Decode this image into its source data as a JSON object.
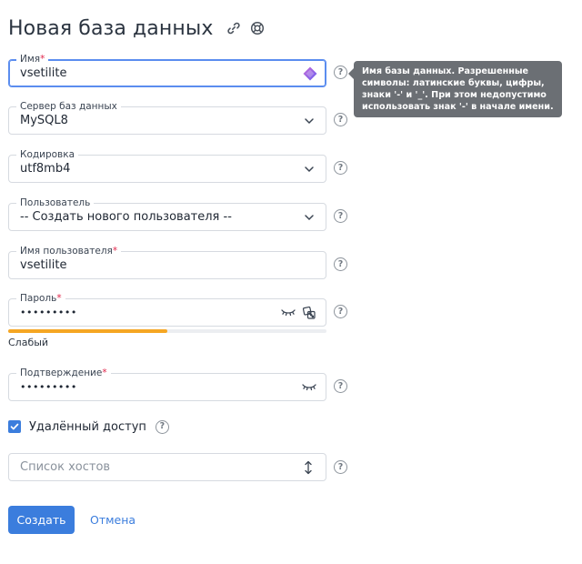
{
  "page": {
    "title": "Новая база данных"
  },
  "tooltip": {
    "text": "Имя базы данных. Разрешенные символы: латинские буквы, цифры, знаки '-' и '_'. При этом недопустимо использовать знак '-' в начале имени."
  },
  "fields": {
    "name": {
      "label": "Имя",
      "value": "vsetilite"
    },
    "server": {
      "label": "Сервер баз данных",
      "value": "MySQL8"
    },
    "encoding": {
      "label": "Кодировка",
      "value": "utf8mb4"
    },
    "user": {
      "label": "Пользователь",
      "value": "-- Создать нового пользователя --"
    },
    "username": {
      "label": "Имя пользователя",
      "value": "vsetilite"
    },
    "password": {
      "label": "Пароль",
      "value": "•••••••••"
    },
    "confirm": {
      "label": "Подтверждение",
      "value": "•••••••••"
    },
    "hosts": {
      "placeholder": "Список хостов"
    }
  },
  "strength": {
    "label": "Слабый",
    "percent": 50,
    "color": "#f5a623"
  },
  "remote": {
    "label": "Удалённый доступ",
    "checked": true
  },
  "actions": {
    "create": "Создать",
    "cancel": "Отмена"
  },
  "colors": {
    "accent": "#3b7ddd",
    "required": "#e0264a",
    "tooltip_bg": "#6b6f74",
    "focus": "#5b8def"
  },
  "icons": {
    "header": [
      "link-icon",
      "lifebuoy-icon"
    ],
    "help": "question-circle-icon",
    "generate": "dice-icon",
    "visibility": "eye-closed-icon"
  }
}
